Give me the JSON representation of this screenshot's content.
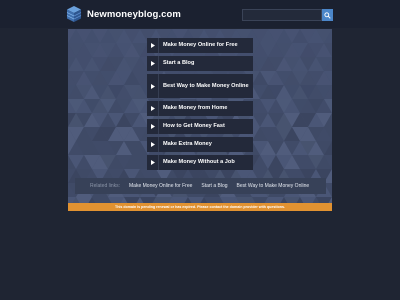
{
  "header": {
    "site_name": "Newmoneyblog.com",
    "logo_icon": "stacked-cube-icon",
    "search": {
      "placeholder": "",
      "value": "",
      "button_icon": "search-icon"
    }
  },
  "main": {
    "links": [
      {
        "label": "Make Money Online for Free"
      },
      {
        "label": "Start a Blog"
      },
      {
        "label": "Best Way to Make Money Online"
      },
      {
        "label": "Make Money from Home"
      },
      {
        "label": "How to Get Money Fast"
      },
      {
        "label": "Make Extra Money"
      },
      {
        "label": "Make Money Without a Job"
      }
    ],
    "link_icon": "play-arrow-icon"
  },
  "related": {
    "title": "Related links:",
    "links": [
      {
        "label": "Make Money Online for Free"
      },
      {
        "label": "Start a Blog"
      },
      {
        "label": "Best Way to Make Money Online"
      }
    ]
  },
  "notice": {
    "text": "This domain is pending renewal or has expired. Please contact the domain provider with questions."
  },
  "colors": {
    "background": "#1f2533",
    "panel": "#455170",
    "link_bg": "#23293a",
    "accent": "#4b86c9",
    "notice": "#e19231"
  }
}
